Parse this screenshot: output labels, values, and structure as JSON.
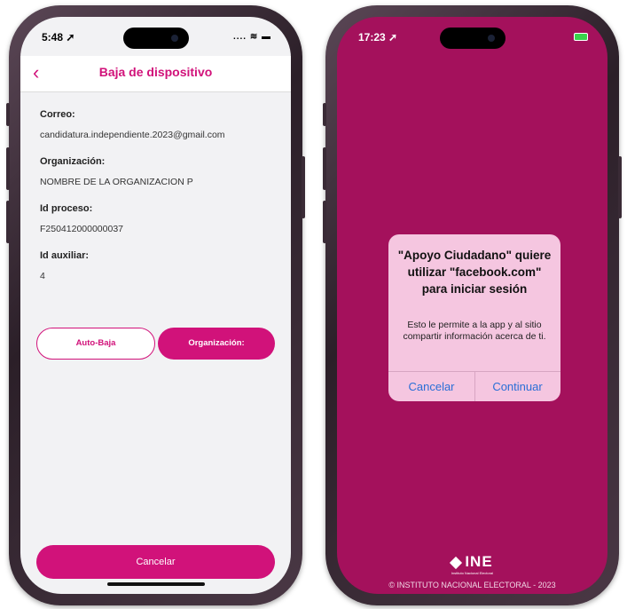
{
  "left_phone": {
    "status": {
      "time": "5:48 ➚",
      "signal": "....  ≋ ▬"
    },
    "navbar": {
      "back_icon": "chevron-left-icon",
      "back_glyph": "‹",
      "title": "Baja de dispositivo"
    },
    "fields": [
      {
        "label": "Correo:",
        "value": "candidatura.independiente.2023@gmail.com"
      },
      {
        "label": "Organización:",
        "value": "NOMBRE DE LA ORGANIZACION P"
      },
      {
        "label": "Id proceso:",
        "value": "F250412000000037"
      },
      {
        "label": "Id auxiliar:",
        "value": "4"
      }
    ],
    "buttons": {
      "auto_baja": "Auto-Baja",
      "organizacion": "Organización:",
      "cancelar": "Cancelar"
    },
    "accent_color": "#d1127a"
  },
  "right_phone": {
    "status": {
      "time": "17:23 ➚"
    },
    "alert": {
      "title": "\"Apoyo Ciudadano\" quiere utilizar \"facebook.com\" para iniciar sesión",
      "message": "Esto le permite a la app y al sitio compartir información acerca de ti.",
      "cancel": "Cancelar",
      "continue": "Continuar"
    },
    "logo": {
      "text": "INE",
      "subtitle": "Instituto Nacional Electoral"
    },
    "footer": "© INSTITUTO NACIONAL ELECTORAL - 2023",
    "background_color": "#a4115c"
  }
}
